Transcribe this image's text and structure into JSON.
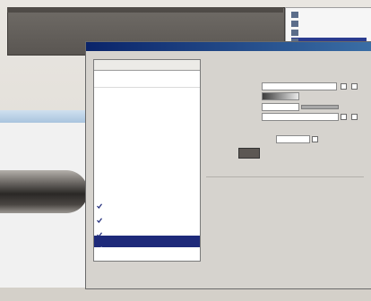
{
  "dialog": {
    "title": ""
  },
  "styles_list": {
    "header": "",
    "blend_options": "",
    "items": [
      {
        "label": "",
        "checked": false,
        "selected": false
      },
      {
        "label": "",
        "checked": false,
        "selected": false
      },
      {
        "label": "",
        "checked": false,
        "selected": false
      },
      {
        "label": "",
        "checked": false,
        "selected": false
      },
      {
        "label": "",
        "checked": false,
        "selected": false
      },
      {
        "label": "",
        "checked": false,
        "selected": false
      },
      {
        "label": "",
        "checked": false,
        "selected": false
      },
      {
        "label": "",
        "checked": true,
        "selected": false
      },
      {
        "label": "",
        "checked": true,
        "selected": false
      },
      {
        "label": "",
        "checked": true,
        "selected": false
      },
      {
        "label": "",
        "checked": true,
        "selected": true
      }
    ]
  },
  "options": {
    "group_title": "",
    "subgroup_title": "",
    "mode_label": "",
    "gradient_label": "",
    "style_label": "",
    "angle_label": "",
    "blend_mode_label": "",
    "color_label": "",
    "color_swatch": "#5c5753"
  },
  "layers_palette": {
    "rows": [
      "",
      "",
      "",
      ""
    ],
    "selected_row": 3
  },
  "colors": {
    "selection": "#1e2a7a",
    "title_start": "#0a246a",
    "title_end": "#3a6ea5"
  }
}
